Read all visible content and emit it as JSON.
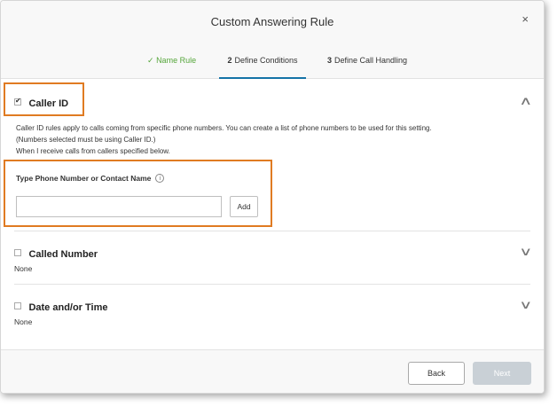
{
  "dialog": {
    "title": "Custom Answering Rule",
    "close_glyph": "×"
  },
  "steps": {
    "done": {
      "check": "✓",
      "label": "Name Rule"
    },
    "active": {
      "num": "2",
      "label": "Define Conditions"
    },
    "next": {
      "num": "3",
      "label": "Define Call Handling"
    }
  },
  "caller_id": {
    "title": "Caller ID",
    "checked": true,
    "expanded": true,
    "chevron": "∧",
    "desc_line1": "Caller ID rules apply to calls coming from specific phone numbers. You can create a list of phone numbers to be used for this setting.",
    "desc_line2": "(Numbers selected must be using Caller ID.)",
    "desc_line3": "When I receive calls from callers specified below.",
    "field_label": "Type Phone Number or Contact Name",
    "info_glyph": "i",
    "input_value": "",
    "input_placeholder": "",
    "add_label": "Add"
  },
  "called_number": {
    "title": "Called Number",
    "checked": false,
    "value": "None",
    "chevron": "∨"
  },
  "date_time": {
    "title": "Date and/or Time",
    "checked": false,
    "value": "None",
    "chevron": "∨"
  },
  "footer": {
    "back_label": "Back",
    "next_label": "Next"
  },
  "colors": {
    "highlight": "#e07b22",
    "step_done": "#55a63a",
    "step_active_underline": "#1473a7",
    "next_disabled": "#c9d0d6"
  },
  "icons": {
    "close": "close-icon",
    "info": "info-icon",
    "chevron_up": "chevron-up-icon",
    "chevron_down": "chevron-down-icon",
    "check": "check-icon"
  }
}
